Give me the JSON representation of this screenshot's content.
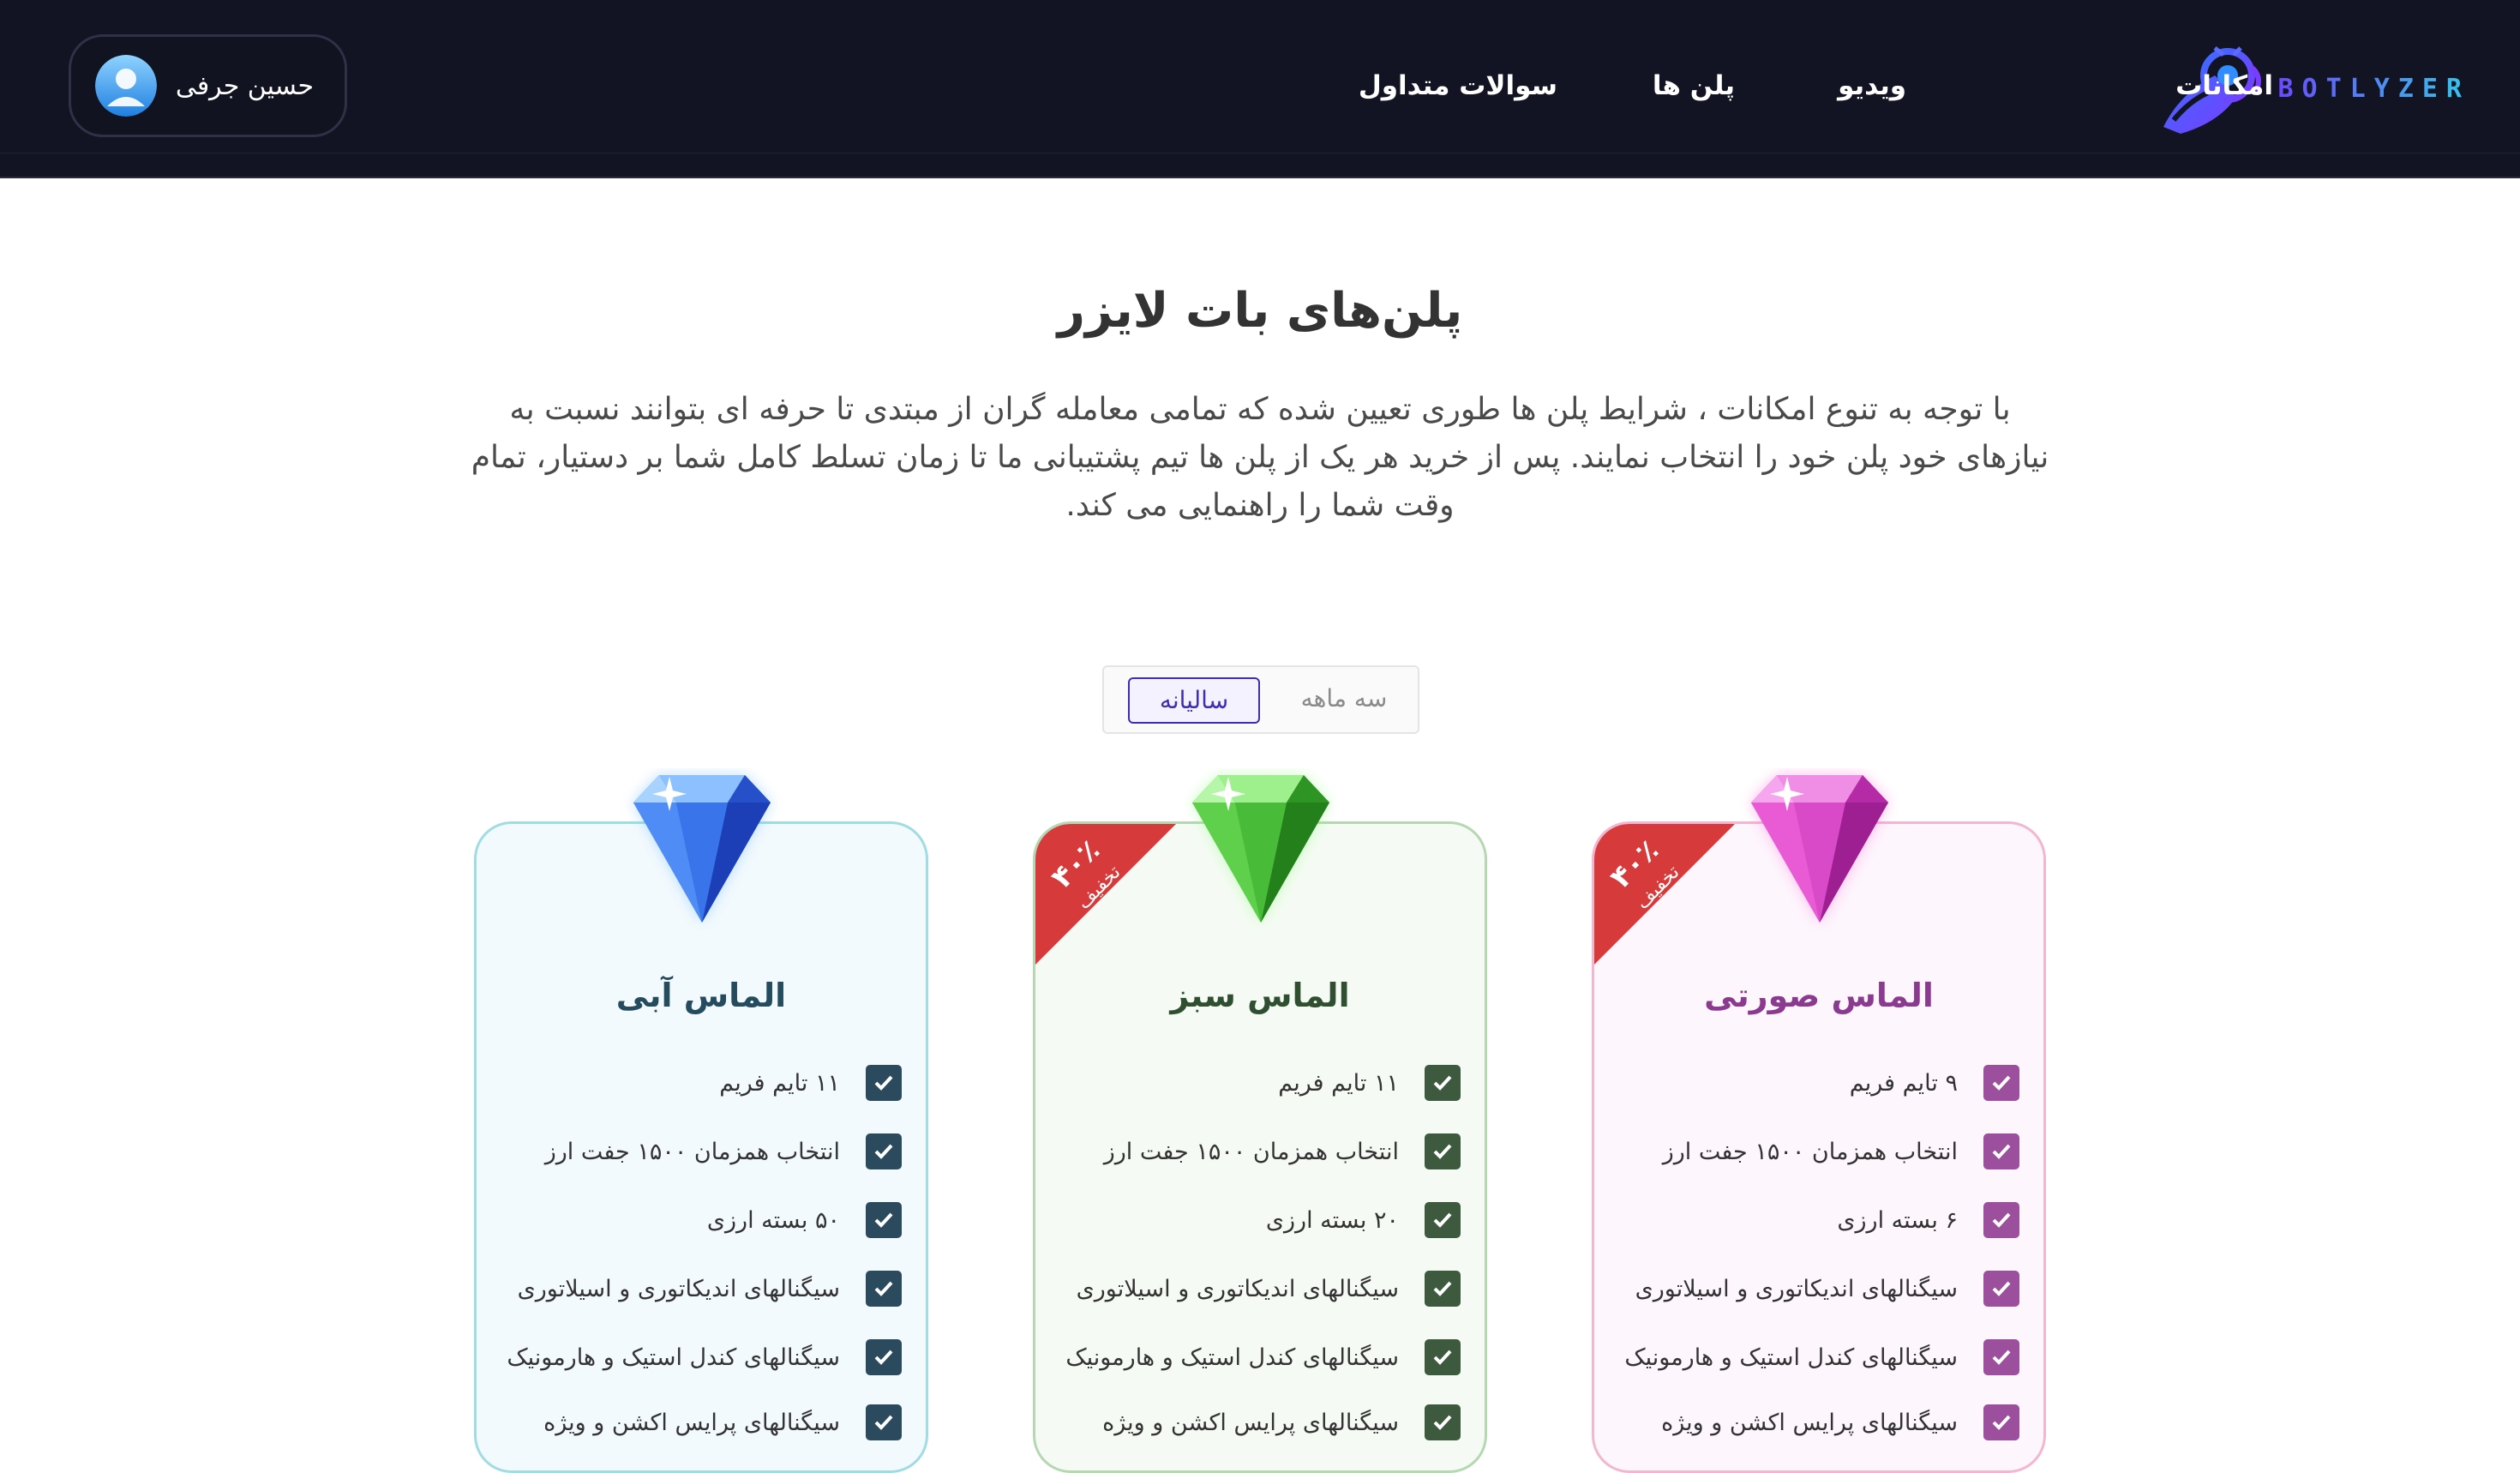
{
  "brand": {
    "name": "BOTLYZER"
  },
  "nav": {
    "features": "امکانات",
    "video": "ویدیو",
    "plans": "پلن ها",
    "faq": "سوالات متداول"
  },
  "user": {
    "name": "حسین جرفی"
  },
  "intro": {
    "title": "پلن‌های بات لایزر",
    "description": "با توجه به تنوع امکانات ، شرایط پلن ها طوری تعیین شده که تمامی معامله گران از مبتدی تا حرفه ای بتوانند نسبت به نیازهای خود پلن خود را انتخاب نمایند. پس از خرید هر یک از پلن ها تیم پشتیبانی ما تا زمان تسلط کامل شما بر دستیار، تمام وقت شما را راهنمایی می کند."
  },
  "billing_toggle": {
    "three_month": "سه ماهه",
    "yearly": "سالیانه",
    "selected": "سالیانه"
  },
  "plans": [
    {
      "title": "الماس صورتی",
      "discount_value": "۴۰٪",
      "discount_label": "تخفیف",
      "features": [
        "۹ تایم فریم",
        "انتخاب همزمان ۱۵۰۰ جفت ارز",
        "۶ بسته ارزی",
        "سیگنالهای اندیکاتوری و اسیلاتوری",
        "سیگنالهای کندل استیک و هارمونیک",
        "سیگنالهای پرایس اکشن و ویژه"
      ]
    },
    {
      "title": "الماس سبز",
      "discount_value": "۴۰٪",
      "discount_label": "تخفیف",
      "features": [
        "۱۱ تایم فریم",
        "انتخاب همزمان ۱۵۰۰ جفت ارز",
        "۲۰ بسته ارزی",
        "سیگنالهای اندیکاتوری و اسیلاتوری",
        "سیگنالهای کندل استیک و هارمونیک",
        "سیگنالهای پرایس اکشن و ویژه"
      ]
    },
    {
      "title": "الماس آبی",
      "features": [
        "۱۱ تایم فریم",
        "انتخاب همزمان ۱۵۰۰ جفت ارز",
        "۵۰ بسته ارزی",
        "سیگنالهای اندیکاتوری و اسیلاتوری",
        "سیگنالهای کندل استیک و هارمونیک",
        "سیگنالهای پرایس اکشن و ویژه"
      ]
    }
  ],
  "colors": {
    "header_bg": "#121423",
    "brand_gradient_start": "#6a4bff",
    "brand_gradient_end": "#35c6e8",
    "pink_accent": "#9b4f9c",
    "green_accent": "#3d5a3e",
    "blue_accent": "#2c4a5d",
    "discount_ribbon": "#d63a3a"
  },
  "icons": {
    "logo": "robot-rocket-icon",
    "avatar": "user-avatar-icon",
    "check": "checkbox-check-icon",
    "gems": [
      "pink-diamond-icon",
      "green-diamond-icon",
      "blue-diamond-icon"
    ]
  }
}
